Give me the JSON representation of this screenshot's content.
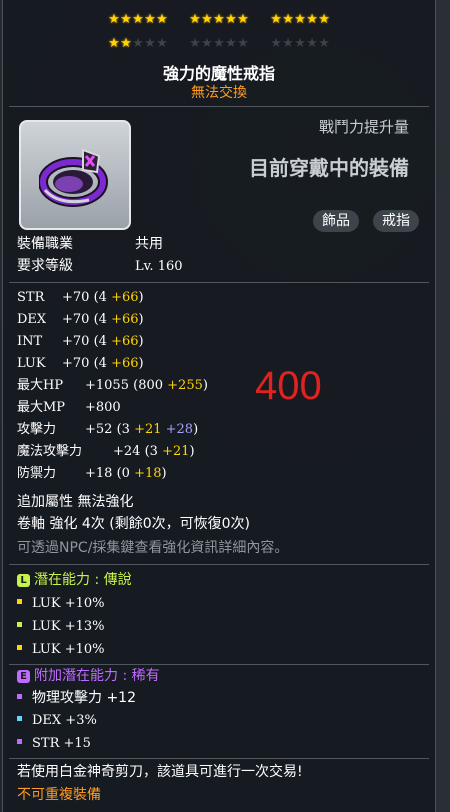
{
  "stars": {
    "row1_filled": 15,
    "row1_total": 15,
    "row2_filled": 2,
    "row2_total": 15,
    "star_char": "★"
  },
  "item": {
    "name": "強力的魔性戒指",
    "trade_status": "無法交換",
    "cp_label": "戰鬥力提升量",
    "equipped_text": "目前穿戴中的裝備",
    "tags": [
      "飾品",
      "戒指"
    ],
    "icon": "purple-ring-icon"
  },
  "requirements": [
    {
      "label": "裝備職業",
      "value": "共用"
    },
    {
      "label": "要求等級",
      "value": "Lv. 160"
    }
  ],
  "stats": [
    {
      "label": "STR",
      "base": "+70",
      "open": "(4",
      "plus": "+66",
      "extra": "",
      "close": ")"
    },
    {
      "label": "DEX",
      "base": "+70",
      "open": "(4",
      "plus": "+66",
      "extra": "",
      "close": ")"
    },
    {
      "label": "INT",
      "base": "+70",
      "open": "(4",
      "plus": "+66",
      "extra": "",
      "close": ")"
    },
    {
      "label": "LUK",
      "base": "+70",
      "open": "(4",
      "plus": "+66",
      "extra": "",
      "close": ")"
    },
    {
      "label": "最大HP",
      "base": "+1055",
      "open": "(800",
      "plus": "+255",
      "extra": "",
      "close": ")"
    },
    {
      "label": "最大MP",
      "base": "+800",
      "open": "",
      "plus": "",
      "extra": "",
      "close": ""
    },
    {
      "label": "攻擊力",
      "base": "+52",
      "open": "(3",
      "plus": "+21",
      "extra": "+28",
      "close": ")"
    },
    {
      "label": "魔法攻擊力",
      "base": "+24",
      "open": "(3",
      "plus": "+21",
      "extra": "",
      "close": ")"
    },
    {
      "label": "防禦力",
      "base": "+18",
      "open": "(0",
      "plus": "+18",
      "extra": "",
      "close": ")"
    }
  ],
  "annotation": "400",
  "extra_lines": [
    "追加屬性  無法強化",
    "卷軸  強化  4次 (剩餘0次，可恢復0次)"
  ],
  "hint": "可透過NPC/採集鍵查看強化資訊詳細內容。",
  "potential": {
    "badge": "L",
    "title": "潛在能力 : 傳說",
    "color": "#c6f34a",
    "lines": [
      "LUK +10%",
      "LUK +13%",
      "LUK +10%"
    ]
  },
  "bonus_potential": {
    "badge": "E",
    "title": "附加潛在能力 : 稀有",
    "color": "#c06bff",
    "lines": [
      "物理攻擊力 +12",
      "DEX +3%",
      "STR +15"
    ]
  },
  "footer": {
    "scissors_note": "若使用白金神奇剪刀，該道具可進行一次交易!",
    "no_duplicate": "不可重複裝備"
  }
}
